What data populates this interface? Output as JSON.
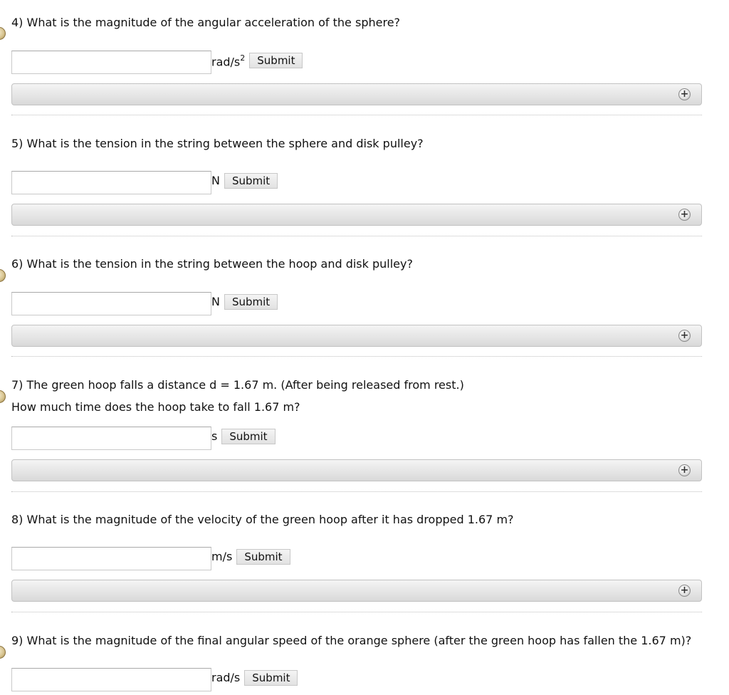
{
  "questions": [
    {
      "text": "4) What is the magnitude of the angular acceleration of the sphere?",
      "unit_base": "rad/s",
      "unit_sup": "2",
      "submit_label": "Submit",
      "input_value": ""
    },
    {
      "text": "5) What is the tension in the string between the sphere and disk pulley?",
      "unit_base": "N",
      "submit_label": "Submit",
      "input_value": ""
    },
    {
      "text": "6) What is the tension in the string between the hoop and disk pulley?",
      "unit_base": "N",
      "submit_label": "Submit",
      "input_value": ""
    },
    {
      "text": "7) The green hoop falls a distance d = 1.67 m. (After being released from rest.)",
      "subtext": "How much time does the hoop take to fall 1.67 m?",
      "unit_base": "s",
      "submit_label": "Submit",
      "input_value": ""
    },
    {
      "text": "8) What is the magnitude of the velocity of the green hoop after it has dropped 1.67 m?",
      "unit_base": "m/s",
      "submit_label": "Submit",
      "input_value": ""
    },
    {
      "text": "9) What is the magnitude of the final angular speed of the orange sphere (after the green hoop has fallen the 1.67 m)?",
      "unit_base": "rad/s",
      "submit_label": "Submit",
      "input_value": ""
    }
  ],
  "icons": {
    "expand": "plus-circle-icon",
    "marker": "question-marker-icon"
  },
  "plus_glyph": "+"
}
